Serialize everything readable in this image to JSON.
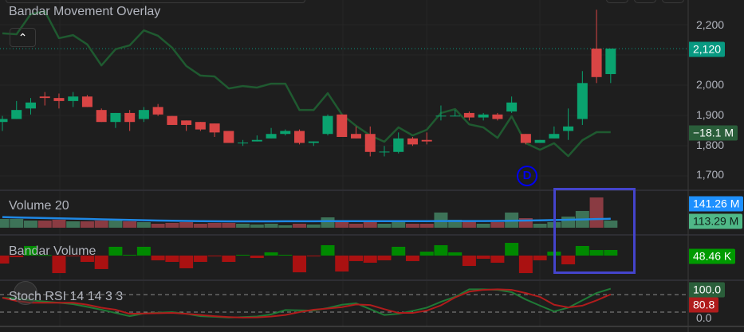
{
  "panes": {
    "main_title": "Bandar Movement Overlay",
    "volume_title": "Volume 20",
    "bandar_title": "Bandar Volume",
    "stoch_title": "Stoch RSI 14 14 3 3",
    "collapse_icon": "chevron-up-icon",
    "marker_label": "D"
  },
  "axis": {
    "price_ticks": [
      "2,200",
      "2,000",
      "1,900",
      "1,800",
      "1,700"
    ],
    "stoch_zero": "0.0"
  },
  "tags": {
    "last_price": "2,120",
    "overlay_value": "−18.1 M",
    "volume_ma": "141.26 M",
    "volume_last": "113.29 M",
    "bandar_last": "48.46 K",
    "stoch_k": "100.0",
    "stoch_d": "80.8"
  },
  "colors": {
    "up": "#0aa36f",
    "down": "#d94545",
    "vol_up": "#3d7358",
    "vol_down": "#8a3b42",
    "bandar_up": "#008a00",
    "bandar_down": "#aa1111",
    "overlay": "#1f5a30",
    "vol_ma": "#1e88e5",
    "stoch_k": "#1f7a36",
    "stoch_d": "#b01c1c",
    "last_price_line": "#089981"
  },
  "chart_data": {
    "type": "candlestick",
    "price_range": [
      1700,
      2200
    ],
    "last_price": 2120,
    "candles": [
      [
        1875,
        1895,
        1845,
        1885
      ],
      [
        1885,
        1945,
        1885,
        1915
      ],
      [
        1920,
        1955,
        1900,
        1940
      ],
      [
        1960,
        1975,
        1930,
        1955
      ],
      [
        1955,
        1970,
        1920,
        1945
      ],
      [
        1945,
        1975,
        1925,
        1960
      ],
      [
        1960,
        1965,
        1925,
        1925
      ],
      [
        1915,
        1920,
        1875,
        1875
      ],
      [
        1875,
        1905,
        1855,
        1905
      ],
      [
        1905,
        1915,
        1845,
        1875
      ],
      [
        1885,
        1925,
        1875,
        1915
      ],
      [
        1925,
        1935,
        1895,
        1900
      ],
      [
        1895,
        1895,
        1865,
        1865
      ],
      [
        1880,
        1880,
        1845,
        1865
      ],
      [
        1875,
        1875,
        1845,
        1850
      ],
      [
        1870,
        1870,
        1825,
        1840
      ],
      [
        1845,
        1845,
        1805,
        1805
      ],
      [
        1805,
        1815,
        1795,
        1806
      ],
      [
        1810,
        1830,
        1810,
        1815
      ],
      [
        1820,
        1855,
        1820,
        1835
      ],
      [
        1835,
        1850,
        1830,
        1845
      ],
      [
        1845,
        1850,
        1800,
        1805
      ],
      [
        1805,
        1810,
        1795,
        1810
      ],
      [
        1835,
        1900,
        1830,
        1895
      ],
      [
        1900,
        1900,
        1825,
        1825
      ],
      [
        1835,
        1860,
        1820,
        1820
      ],
      [
        1835,
        1860,
        1760,
        1775
      ],
      [
        1775,
        1795,
        1760,
        1776
      ],
      [
        1775,
        1840,
        1770,
        1820
      ],
      [
        1820,
        1825,
        1795,
        1800
      ],
      [
        1815,
        1840,
        1800,
        1810
      ],
      [
        1895,
        1930,
        1880,
        1896
      ],
      [
        1895,
        1915,
        1895,
        1896
      ],
      [
        1905,
        1910,
        1880,
        1890
      ],
      [
        1890,
        1905,
        1880,
        1900
      ],
      [
        1900,
        1905,
        1880,
        1885
      ],
      [
        1910,
        1960,
        1905,
        1940
      ],
      [
        1835,
        1835,
        1800,
        1805
      ],
      [
        1805,
        1815,
        1805,
        1815
      ],
      [
        1820,
        1860,
        1820,
        1835
      ],
      [
        1845,
        1920,
        1815,
        1860
      ],
      [
        1885,
        2045,
        1865,
        2005
      ],
      [
        2120,
        2250,
        2005,
        2025
      ],
      [
        2035,
        2120,
        2005,
        2120
      ]
    ],
    "overlay": [
      2171,
      2168,
      2235,
      2245,
      2155,
      2165,
      2134,
      2064,
      2118,
      2131,
      2181,
      2163,
      2123,
      2062,
      2030,
      2027,
      1987,
      1995,
      1990,
      2003,
      2003,
      1915,
      1915,
      1971,
      1900,
      1862,
      1830,
      1809,
      1857,
      1830,
      1849,
      1905,
      1918,
      1867,
      1857,
      1822,
      1894,
      1804,
      1782,
      1804,
      1761,
      1814,
      1841,
      1841
    ],
    "volume_m": [
      139,
      139,
      113,
      113,
      126,
      101,
      101,
      113,
      113,
      101,
      88,
      63,
      76,
      88,
      63,
      76,
      76,
      63,
      50,
      63,
      38,
      63,
      50,
      164,
      113,
      63,
      113,
      63,
      88,
      63,
      63,
      240,
      126,
      101,
      63,
      88,
      240,
      151,
      63,
      88,
      176,
      265,
      479,
      113.29
    ],
    "volume_ma_m": [
      168,
      163,
      158,
      153,
      148,
      143,
      138,
      133,
      128,
      123,
      118,
      114,
      110,
      107,
      104,
      102,
      101,
      101,
      101,
      101,
      102,
      102,
      103,
      104,
      104,
      104,
      104,
      104,
      104,
      104,
      104,
      105,
      105,
      106,
      106,
      107,
      110,
      114,
      117,
      121,
      126,
      131,
      137,
      141.26
    ],
    "bandar_k": [
      -69,
      -14,
      83,
      5,
      -152,
      -5,
      -55,
      -117,
      76,
      7,
      76,
      -41,
      -55,
      -110,
      -55,
      -7,
      -55,
      7,
      -21,
      28,
      7,
      -145,
      -7,
      90,
      -138,
      -48,
      -62,
      -41,
      76,
      -48,
      34,
      90,
      28,
      -90,
      -28,
      -62,
      110,
      -152,
      -41,
      34,
      -76,
      83,
      48,
      48.46
    ],
    "stoch_k": [
      69,
      67,
      60,
      56,
      52,
      47,
      38,
      28,
      17,
      6,
      15,
      18,
      20,
      14,
      6,
      4,
      1,
      3,
      5,
      12,
      27,
      26,
      25,
      34,
      45,
      50,
      30,
      10,
      14,
      24,
      35,
      55,
      72,
      98,
      98,
      96,
      88,
      63,
      42,
      22,
      35,
      60,
      85,
      100
    ],
    "stoch_d": [
      69,
      58,
      52,
      52,
      52,
      52,
      45,
      35,
      28,
      14,
      15,
      16,
      17,
      14,
      10,
      6,
      3,
      1,
      2,
      5,
      10,
      20,
      28,
      32,
      37,
      46,
      44,
      30,
      17,
      17,
      25,
      43,
      70,
      90,
      96,
      98,
      96,
      85,
      72,
      45,
      36,
      42,
      60,
      80.8
    ],
    "stoch_levels": [
      80,
      20
    ]
  }
}
